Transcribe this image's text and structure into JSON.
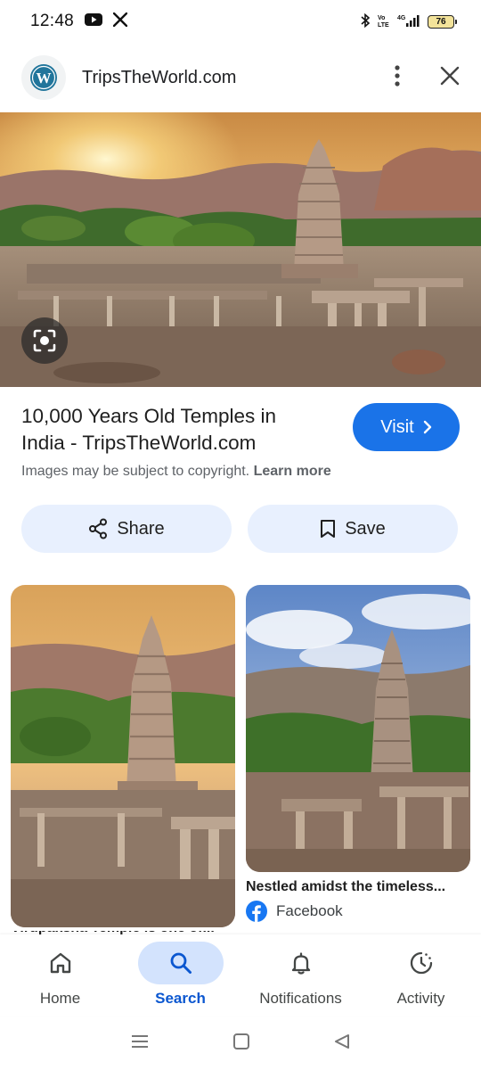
{
  "status_bar": {
    "time": "12:48",
    "battery": "76",
    "network": "4G"
  },
  "header": {
    "site_name": "TripsTheWorld.com",
    "logo_icon": "wordpress-icon",
    "more_icon": "more-vert-icon",
    "close_icon": "close-icon"
  },
  "result": {
    "title": "10,000 Years Old Temples in India - TripsTheWorld.com",
    "visit_label": "Visit",
    "copyright_text": "Images may be subject to copyright.",
    "learn_more": "Learn more"
  },
  "actions": {
    "share_label": "Share",
    "save_label": "Save"
  },
  "related": [
    {
      "caption": "Nestled amidst the timeless...",
      "source": "Facebook"
    },
    {
      "caption": "Virupaksha Temple is one of..."
    }
  ],
  "bottom_nav": [
    {
      "label": "Home",
      "icon": "home-icon",
      "active": false
    },
    {
      "label": "Search",
      "icon": "search-icon",
      "active": true
    },
    {
      "label": "Notifications",
      "icon": "bell-icon",
      "active": false
    },
    {
      "label": "Activity",
      "icon": "history-icon",
      "active": false
    }
  ],
  "colors": {
    "accent": "#1a73e8",
    "pill_bg": "#e8f0fe",
    "nav_active_bg": "#d3e3fd",
    "nav_active_text": "#0b57d0"
  }
}
